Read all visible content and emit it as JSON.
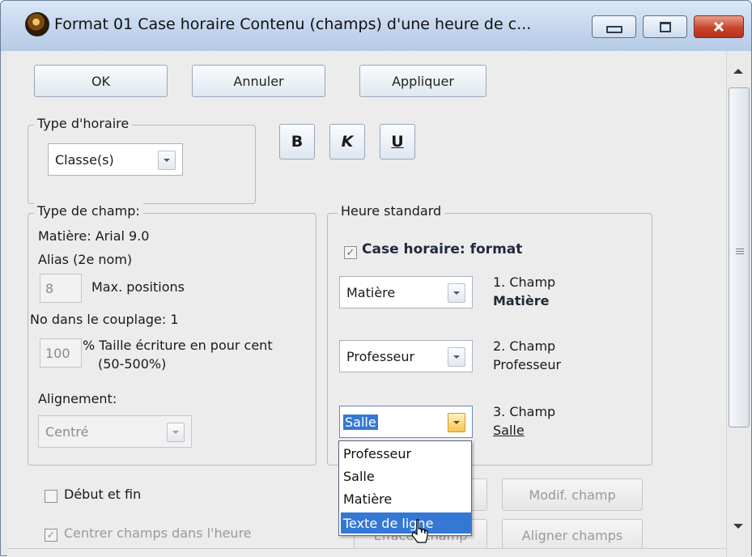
{
  "window": {
    "title": "Format 01  Case horaire  Contenu (champs) d'une heure de c...",
    "app_icon": "clock-app-icon",
    "controls": {
      "minimize_icon": "minimize-icon",
      "maximize_icon": "maximize-icon",
      "close_icon": "close-icon"
    }
  },
  "buttons": {
    "ok": "OK",
    "cancel": "Annuler",
    "apply": "Appliquer"
  },
  "type_horaire": {
    "legend": "Type d'horaire",
    "value": "Classe(s)"
  },
  "format_buttons": {
    "bold": "B",
    "italic": "K",
    "underline": "U"
  },
  "type_champ": {
    "legend": "Type de champ:",
    "font_line": "Matière: Arial 9.0",
    "alias_line": "Alias (2e nom)",
    "max_positions_value": "8",
    "max_positions_label": "Max. positions",
    "couplage_line": "No dans le couplage: 1",
    "size_value": "100",
    "size_label_1": "% Taille écriture en pour cent",
    "size_label_2": "(50-500%)",
    "alignment_label": "Alignement:",
    "alignment_value": "Centré"
  },
  "heure_standard": {
    "legend": "Heure standard",
    "case_horaire_label": "Case horaire: format",
    "case_horaire_checked": true,
    "field1": {
      "value": "Matière",
      "caption": "1. Champ",
      "name": "Matière"
    },
    "field2": {
      "value": "Professeur",
      "caption": "2. Champ",
      "name": "Professeur"
    },
    "field3": {
      "value": "Salle",
      "caption": "3. Champ",
      "name": "Salle"
    }
  },
  "dropdown": {
    "items": [
      "Professeur",
      "Salle",
      "Matière",
      "Texte de ligne"
    ],
    "highlighted_index": 3
  },
  "bottom": {
    "debut_fin_label": "Début et fin",
    "debut_fin_checked": false,
    "centrer_label": "Centrer champs dans l'heure",
    "centrer_checked": true,
    "modif_champ": "Modif. champ",
    "hidden_button_partial": "Effacer champ",
    "aligner_champ": "Aligner champs"
  },
  "colors": {
    "selection": "#3478d4",
    "title_bar": "#c4d6ee",
    "close_button": "#c9452c"
  }
}
